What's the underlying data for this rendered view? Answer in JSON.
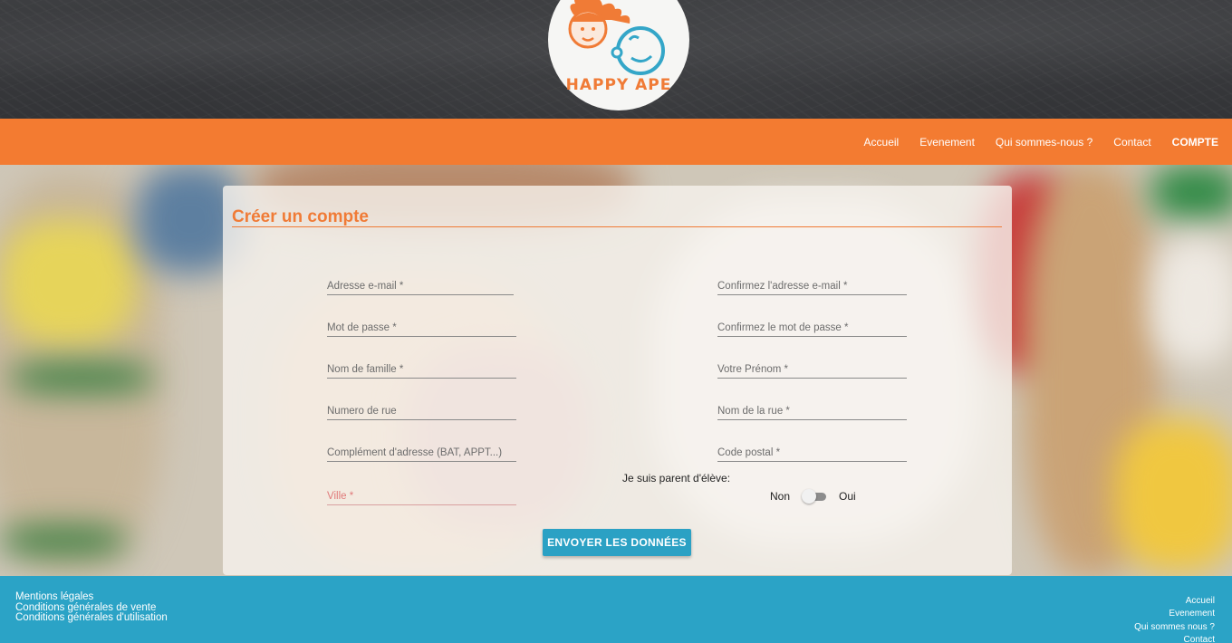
{
  "brand": {
    "logo_text": "HAPPY APE"
  },
  "nav": {
    "items": [
      {
        "label": "Accueil"
      },
      {
        "label": "Evenement"
      },
      {
        "label": "Qui sommes-nous ?"
      },
      {
        "label": "Contact"
      },
      {
        "label": "COMPTE"
      }
    ]
  },
  "form": {
    "title": "Créer un compte",
    "fields": {
      "email": {
        "placeholder": "Adresse e-mail *"
      },
      "email_confirm": {
        "placeholder": "Confirmez l'adresse e-mail *"
      },
      "password": {
        "placeholder": "Mot de passe *"
      },
      "password_confirm": {
        "placeholder": "Confirmez le mot de passe *"
      },
      "last_name": {
        "placeholder": "Nom de famille *"
      },
      "first_name": {
        "placeholder": "Votre Prénom *"
      },
      "street_number": {
        "placeholder": "Numero de rue"
      },
      "street_name": {
        "placeholder": "Nom de la rue *"
      },
      "address_extra": {
        "placeholder": "Complément d'adresse (BAT, APPT...)"
      },
      "postal_code": {
        "placeholder": "Code postal *"
      },
      "city": {
        "placeholder": "Ville *"
      }
    },
    "parent_question": "Je suis parent d'élève:",
    "toggle": {
      "off_label": "Non",
      "on_label": "Oui",
      "state": "off"
    },
    "submit_label": "ENVOYER LES DONNÉES"
  },
  "footer": {
    "left_links": [
      "Mentions légales",
      "Conditions générales de vente",
      "Conditions générales d'utilisation"
    ],
    "right_links": [
      "Accueil",
      "Evenement",
      "Qui sommes nous ?",
      "Contact"
    ]
  },
  "colors": {
    "accent_orange": "#f37b31",
    "accent_blue": "#2ba3c6"
  }
}
